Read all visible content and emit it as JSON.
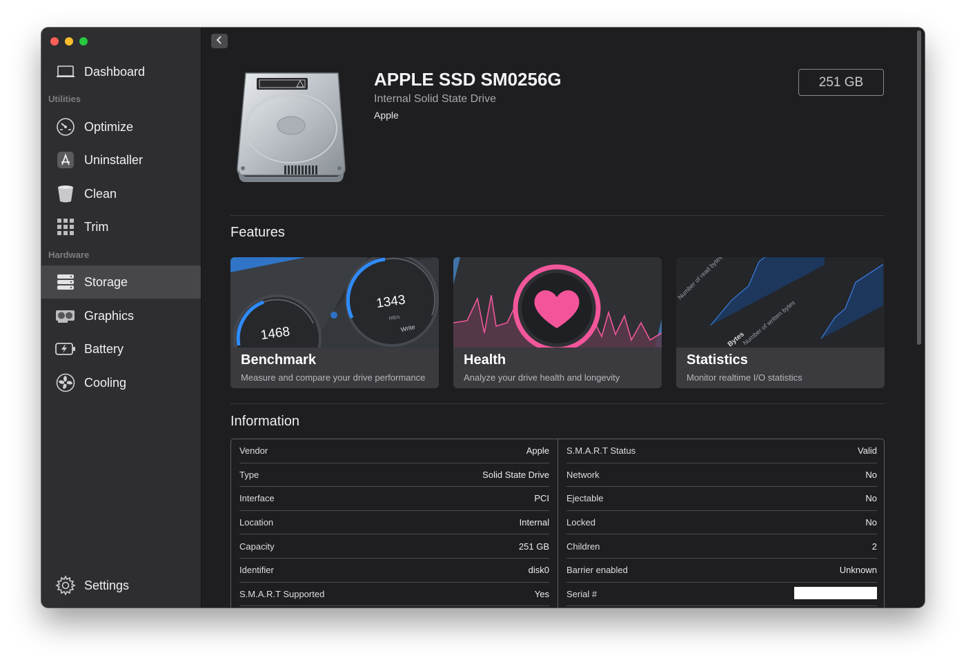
{
  "sidebar": {
    "dashboard": "Dashboard",
    "utilities_label": "Utilities",
    "utilities": [
      "Optimize",
      "Uninstaller",
      "Clean",
      "Trim"
    ],
    "hardware_label": "Hardware",
    "hardware": [
      "Storage",
      "Graphics",
      "Battery",
      "Cooling"
    ],
    "active_item": "Storage",
    "settings": "Settings"
  },
  "drive": {
    "name": "APPLE SSD SM0256G",
    "kind": "Internal Solid State Drive",
    "vendor": "Apple",
    "capacity_badge": "251 GB"
  },
  "features": {
    "heading": "Features",
    "cards": [
      {
        "title": "Benchmark",
        "desc": "Measure and compare your drive performance",
        "gauge_left": "1468",
        "gauge_right": "1343",
        "gauge_unit": "MB/s",
        "gauge_label": "Write"
      },
      {
        "title": "Health",
        "desc": "Analyze your drive health and longevity"
      },
      {
        "title": "Statistics",
        "desc": "Monitor realtime I/O statistics",
        "art_label_1": "Number of read bytes",
        "art_label_2": "Number of written bytes",
        "art_label_3": "Bytes"
      }
    ]
  },
  "information": {
    "heading": "Information",
    "left": [
      {
        "key": "Vendor",
        "value": "Apple"
      },
      {
        "key": "Type",
        "value": "Solid State Drive"
      },
      {
        "key": "Interface",
        "value": "PCI"
      },
      {
        "key": "Location",
        "value": "Internal"
      },
      {
        "key": "Capacity",
        "value": "251 GB"
      },
      {
        "key": "Identifier",
        "value": "disk0"
      },
      {
        "key": "S.M.A.R.T Supported",
        "value": "Yes"
      }
    ],
    "right": [
      {
        "key": "S.M.A.R.T Status",
        "value": "Valid"
      },
      {
        "key": "Network",
        "value": "No"
      },
      {
        "key": "Ejectable",
        "value": "No"
      },
      {
        "key": "Locked",
        "value": "No"
      },
      {
        "key": "Children",
        "value": "2"
      },
      {
        "key": "Barrier enabled",
        "value": "Unknown"
      },
      {
        "key": "Serial #",
        "value": ""
      }
    ]
  },
  "colors": {
    "accent_health": "#f2569b",
    "accent_benchmark": "#2f8cff",
    "window_bg": "#1e1e21",
    "sidebar_bg": "#2e2e31"
  },
  "icons": [
    "laptop-icon",
    "speedometer-icon",
    "app-store-icon",
    "trash-bin-icon",
    "grid-icon",
    "storage-stack-icon",
    "gpu-icon",
    "battery-icon",
    "fan-icon",
    "gear-icon",
    "chevron-left-icon"
  ]
}
